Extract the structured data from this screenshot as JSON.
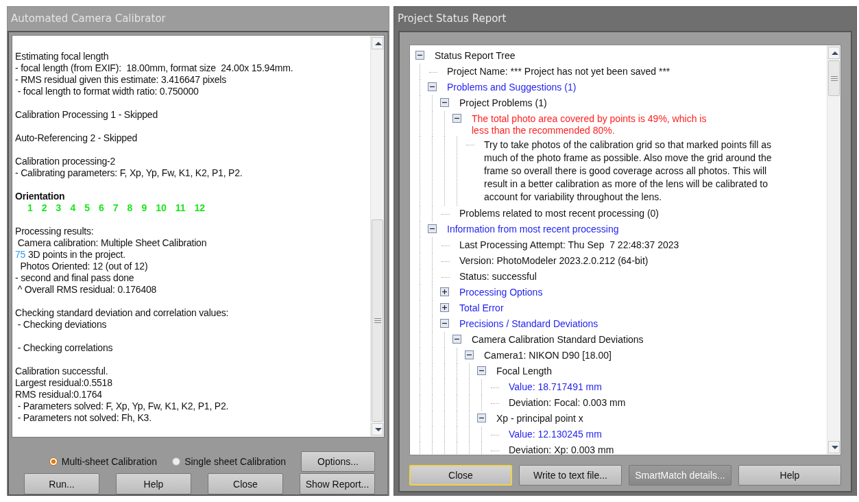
{
  "calibrator": {
    "title": "Automated Camera Calibrator",
    "log": [
      {
        "kind": "text",
        "lines": [
          "Estimating focal length",
          "- focal length (from EXIF):  18.00mm, format size  24.00x 15.94mm.",
          "- RMS residual given this estimate: 3.416647 pixels",
          " - focal length to format width ratio: 0.750000"
        ]
      },
      {
        "kind": "text",
        "lines": [
          "Calibration Processing 1 - Skipped"
        ]
      },
      {
        "kind": "text",
        "lines": [
          "Auto-Referencing 2 - Skipped"
        ]
      },
      {
        "kind": "text",
        "lines": [
          "Calibration processing-2",
          "- Calibrating parameters: F, Xp, Yp, Fw, K1, K2, P1, P2."
        ]
      },
      {
        "kind": "orientation",
        "title": "Orientation",
        "numbers": [
          "1",
          "2",
          "3",
          "4",
          "5",
          "6",
          "7",
          "8",
          "9",
          "10",
          "11",
          "12"
        ]
      },
      {
        "kind": "text",
        "lines": [
          "Processing results:",
          " Camera calibration: Multiple Sheet Calibration",
          {
            "number": "75",
            "text": "3D points in the project."
          },
          "  Photos Oriented: 12 (out of 12)",
          "- second and final pass done",
          " ^ Overall RMS residual: 0.176408"
        ]
      },
      {
        "kind": "text",
        "lines": [
          "Checking standard deviation and correlation values:",
          " - Checking deviations"
        ]
      },
      {
        "kind": "text",
        "lines": [
          " - Checking correlations"
        ]
      },
      {
        "kind": "text",
        "lines": [
          "Calibration successful.",
          "Largest residual:0.5518",
          "RMS residual:0.1764",
          " - Parameters solved: F, Xp, Yp, Fw, K1, K2, P1, P2.",
          " - Parameters not solved: Fh, K3."
        ]
      }
    ],
    "modes": [
      {
        "label": "Multi-sheet Calibration",
        "selected": true
      },
      {
        "label": "Single sheet Calibration",
        "selected": false
      }
    ],
    "options_button": "Options...",
    "buttons": [
      "Run...",
      "Help",
      "Close",
      "Show Report..."
    ]
  },
  "report": {
    "title": "Project Status Report",
    "tree": [
      {
        "text": "Status Report Tree",
        "kind": "text",
        "expanded": true,
        "children": [
          {
            "text": "Project Name: *** Project has not yet been saved ***",
            "kind": "text"
          },
          {
            "text": "Problems and Suggestions (1)",
            "kind": "link",
            "expanded": true,
            "children": [
              {
                "text": "Project Problems (1)",
                "kind": "text",
                "expanded": true,
                "children": [
                  {
                    "text": "The total photo area covered by points is 49%, which is less than the recommended 80%.",
                    "kind": "warning",
                    "expanded": true,
                    "children": [
                      {
                        "text": "Try to take photos of the calibration grid so that marked points fill as much of the photo frame as possible. Also move the grid around the frame so overall there is good coverage across all photos. This will result in a better calibration as more of the lens will be calibrated to account for variability throughout the lens.",
                        "kind": "note"
                      }
                    ]
                  }
                ]
              },
              {
                "text": "Problems related to most recent processing (0)",
                "kind": "text"
              }
            ]
          },
          {
            "text": "Information from most recent processing",
            "kind": "link",
            "expanded": true,
            "children": [
              {
                "text": "Last Processing Attempt: Thu Sep  7 22:48:37 2023",
                "kind": "text"
              },
              {
                "text": "Version: PhotoModeler 2023.2.0.212 (64-bit)",
                "kind": "text"
              },
              {
                "text": "Status: successful",
                "kind": "text"
              },
              {
                "text": "Processing Options",
                "kind": "link",
                "expanded": false
              },
              {
                "text": "Total Error",
                "kind": "link",
                "expanded": false
              },
              {
                "text": "Precisions / Standard Deviations",
                "kind": "link",
                "expanded": true,
                "children": [
                  {
                    "text": "Camera Calibration Standard Deviations",
                    "kind": "text",
                    "expanded": true,
                    "children": [
                      {
                        "text": "Camera1: NIKON D90 [18.00]",
                        "kind": "text",
                        "expanded": true,
                        "children": [
                          {
                            "text": "Focal Length",
                            "kind": "text",
                            "expanded": true,
                            "children": [
                              {
                                "text": "Value: 18.717491 mm",
                                "kind": "link"
                              },
                              {
                                "text": "Deviation: Focal: 0.003 mm",
                                "kind": "text"
                              }
                            ]
                          },
                          {
                            "text": "Xp - principal point x",
                            "kind": "text",
                            "expanded": true,
                            "children": [
                              {
                                "text": "Value: 12.130245 mm",
                                "kind": "link"
                              },
                              {
                                "text": "Deviation: Xp: 0.003 mm",
                                "kind": "text"
                              }
                            ]
                          }
                        ]
                      }
                    ]
                  }
                ]
              }
            ]
          }
        ]
      }
    ],
    "buttons": [
      {
        "label": "Close",
        "focused": true,
        "disabled": false
      },
      {
        "label": "Write to text file...",
        "focused": false,
        "disabled": false
      },
      {
        "label": "SmartMatch details...",
        "focused": false,
        "disabled": true
      },
      {
        "label": "Help",
        "focused": false,
        "disabled": false
      }
    ]
  }
}
